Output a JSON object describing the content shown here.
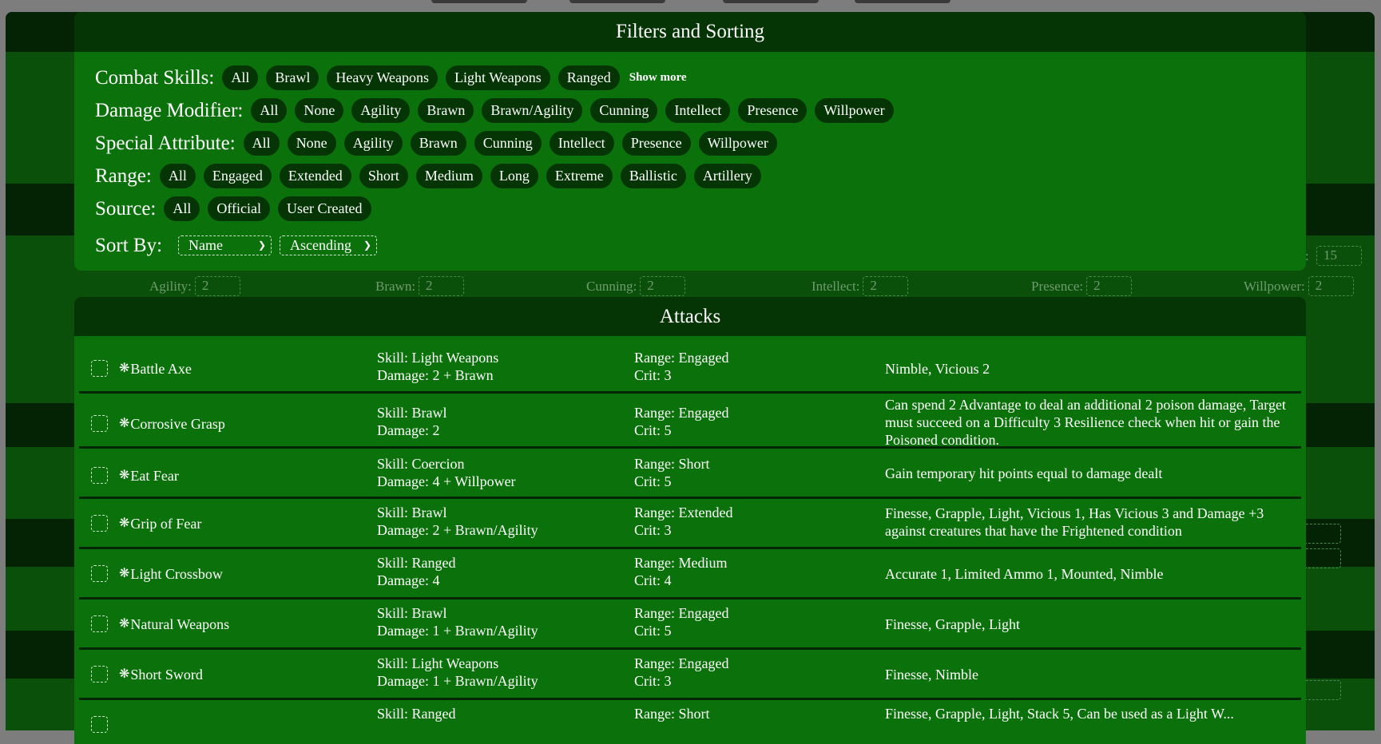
{
  "filters": {
    "title": "Filters and Sorting",
    "combat_skills": {
      "label": "Combat Skills:",
      "options": [
        "All",
        "Brawl",
        "Heavy Weapons",
        "Light Weapons",
        "Ranged"
      ],
      "show_more": "Show more"
    },
    "damage_modifier": {
      "label": "Damage Modifier:",
      "options": [
        "All",
        "None",
        "Agility",
        "Brawn",
        "Brawn/Agility",
        "Cunning",
        "Intellect",
        "Presence",
        "Willpower"
      ]
    },
    "special_attribute": {
      "label": "Special Attribute:",
      "options": [
        "All",
        "None",
        "Agility",
        "Brawn",
        "Cunning",
        "Intellect",
        "Presence",
        "Willpower"
      ]
    },
    "range": {
      "label": "Range:",
      "options": [
        "All",
        "Engaged",
        "Extended",
        "Short",
        "Medium",
        "Long",
        "Extreme",
        "Ballistic",
        "Artillery"
      ]
    },
    "source": {
      "label": "Source:",
      "options": [
        "All",
        "Official",
        "User Created"
      ]
    },
    "sort": {
      "label": "Sort By:",
      "field": "Name",
      "order": "Ascending"
    }
  },
  "background": {
    "top_field_suffix": ":",
    "top_field_value": "15",
    "stats": [
      {
        "label": "Agility:",
        "value": "2"
      },
      {
        "label": "Brawn:",
        "value": "2"
      },
      {
        "label": "Cunning:",
        "value": "2"
      },
      {
        "label": "Intellect:",
        "value": "2"
      },
      {
        "label": "Presence:",
        "value": "2"
      },
      {
        "label": "Willpower:",
        "value": "2"
      }
    ]
  },
  "attacks": {
    "title": "Attacks",
    "rows": [
      {
        "name": "Battle Axe",
        "skill": "Skill: Light Weapons",
        "damage": "Damage: 2 + Brawn",
        "range": "Range: Engaged",
        "crit": "Crit: 3",
        "qualities": "Nimble, Vicious 2"
      },
      {
        "name": "Corrosive Grasp",
        "skill": "Skill: Brawl",
        "damage": "Damage: 2",
        "range": "Range: Engaged",
        "crit": "Crit: 5",
        "qualities": "Can spend 2 Advantage to deal an additional 2 poison damage, Target must succeed on a Difficulty 3 Resilience check when hit or gain the Poisoned condition."
      },
      {
        "name": "Eat Fear",
        "skill": "Skill: Coercion",
        "damage": "Damage: 4 + Willpower",
        "range": "Range: Short",
        "crit": "Crit: 5",
        "qualities": "Gain temporary hit points equal to damage dealt"
      },
      {
        "name": "Grip of Fear",
        "skill": "Skill: Brawl",
        "damage": "Damage: 2 + Brawn/Agility",
        "range": "Range: Extended",
        "crit": "Crit: 3",
        "qualities": "Finesse, Grapple, Light, Vicious 1, Has Vicious 3 and Damage +3 against creatures that have the Frightened condition"
      },
      {
        "name": "Light Crossbow",
        "skill": "Skill: Ranged",
        "damage": "Damage: 4",
        "range": "Range: Medium",
        "crit": "Crit: 4",
        "qualities": "Accurate 1, Limited Ammo 1, Mounted, Nimble"
      },
      {
        "name": "Natural Weapons",
        "skill": "Skill: Brawl",
        "damage": "Damage: 1 + Brawn/Agility",
        "range": "Range: Engaged",
        "crit": "Crit: 5",
        "qualities": "Finesse, Grapple, Light"
      },
      {
        "name": "Short Sword",
        "skill": "Skill: Light Weapons",
        "damage": "Damage: 1 + Brawn/Agility",
        "range": "Range: Engaged",
        "crit": "Crit: 3",
        "qualities": "Finesse, Nimble"
      },
      {
        "name": "",
        "skill": "Skill: Ranged",
        "damage": "",
        "range": "Range: Short",
        "crit": "",
        "qualities": "Finesse, Grapple, Light, Stack 5, Can be used as a Light W..."
      }
    ]
  },
  "icons": {
    "row_icon": "gear-icon",
    "select_icon": "chevron-down-icon"
  },
  "colors": {
    "panel": "#0b720b",
    "header": "#053505",
    "chip": "#053505",
    "page": "#063006",
    "overlay": "#7d7d7d"
  }
}
